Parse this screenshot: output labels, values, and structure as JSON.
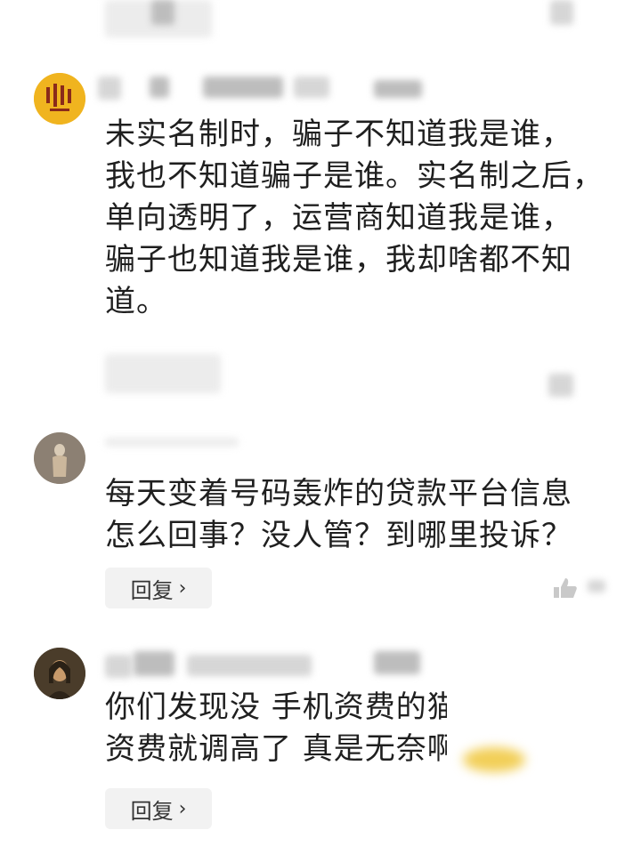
{
  "comments": [
    {
      "text_lines": [
        "未实名制时，骗子不知道我是谁，",
        "我也不知道骗子是谁。实名制之后，",
        "单向透明了，运营商知道我是谁，",
        "骗子也知道我是谁，我却啥都不知",
        "道。"
      ]
    },
    {
      "text_lines": [
        "每天变着号码轰炸的贷款平台信息",
        "怎么回事？没人管？到哪里投诉？"
      ],
      "reply_label": "回复"
    },
    {
      "text_lines": [
        "你们发现没 手机资费的猫",
        "资费就调高了 真是无奈啊"
      ],
      "reply_label": "回复"
    }
  ],
  "icons": {
    "reply_chevron": "chevron-right-icon",
    "like": "thumb-up-icon"
  },
  "colors": {
    "text": "#1f1f1f",
    "reply_bg": "#f2f2f2",
    "avatar1_bg": "#f0b41f"
  }
}
